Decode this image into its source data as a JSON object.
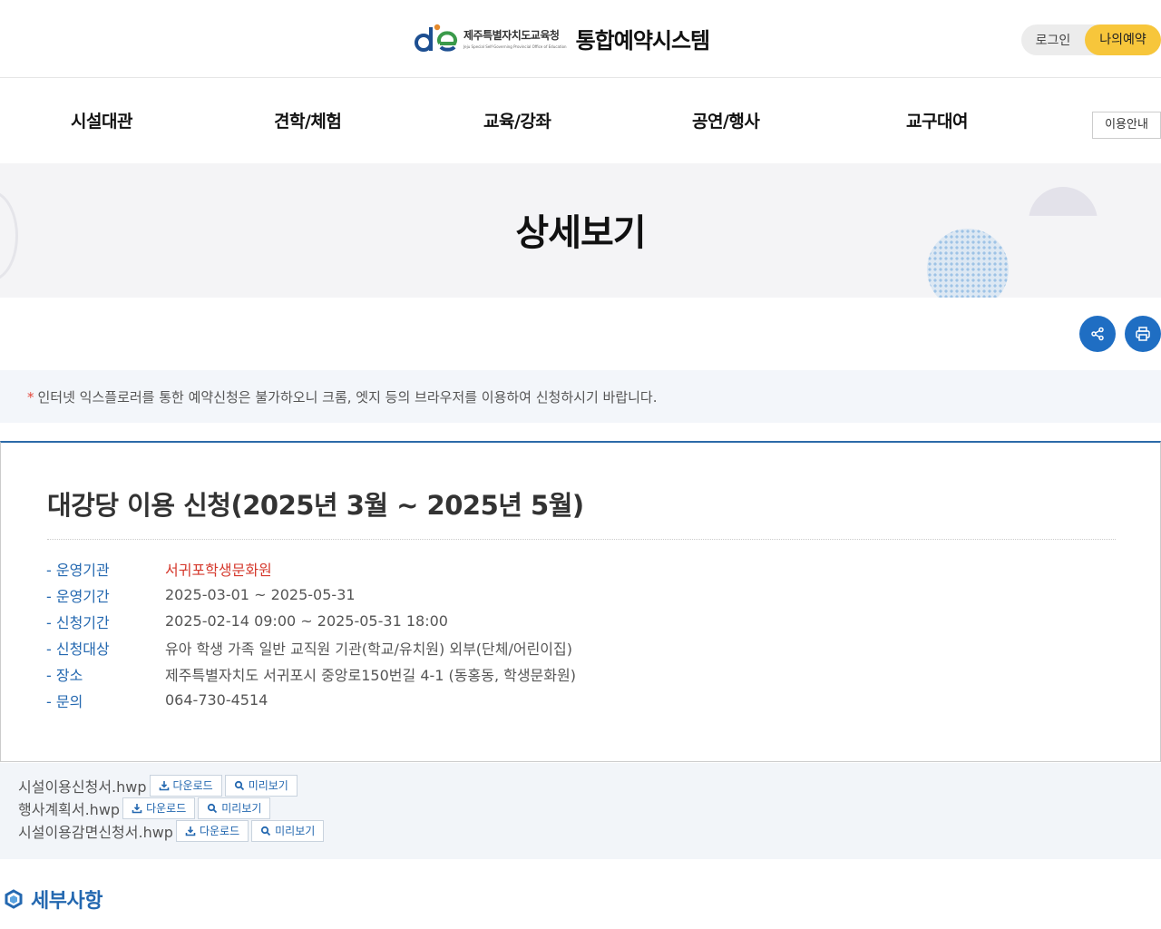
{
  "header": {
    "org_name": "제주특별자치도교육청",
    "org_name_en": "Jeju Special Self-Governing Provincial Office of Education",
    "system_title": "통합예약시스템",
    "login_label": "로그인",
    "my_reservation_label": "나의예약"
  },
  "nav": {
    "items": [
      {
        "label": "시설대관"
      },
      {
        "label": "견학/체험"
      },
      {
        "label": "교육/강좌"
      },
      {
        "label": "공연/행사"
      },
      {
        "label": "교구대여"
      }
    ],
    "guide_label": "이용안내"
  },
  "banner": {
    "title": "상세보기"
  },
  "actions": {
    "share_icon": "share-icon",
    "print_icon": "print-icon",
    "button_color": "#1f6ec3"
  },
  "notice": {
    "star": "*",
    "text": "인터넷 익스플로러를 통한 예약신청은 불가하오니 크롬, 엣지 등의 브라우저를 이용하여 신청하시기 바랍니다."
  },
  "detail": {
    "title": "대강당 이용 신청(2025년 3월 ~ 2025년 5월)",
    "info": [
      {
        "label": "- 운영기관",
        "value": "서귀포학생문화원"
      },
      {
        "label": "- 운영기간",
        "value": "2025-03-01 ~ 2025-05-31"
      },
      {
        "label": "- 신청기간",
        "value": "2025-02-14 09:00 ~ 2025-05-31 18:00"
      },
      {
        "label": "- 신청대상",
        "value": "유아 학생 가족 일반 교직원 기관(학교/유치원) 외부(단체/어린이집)"
      },
      {
        "label": "- 장소",
        "value": "제주특별자치도 서귀포시 중앙로150번길 4-1 (동홍동, 학생문화원)"
      },
      {
        "label": "- 문의",
        "value": "064-730-4514"
      }
    ]
  },
  "attachments": {
    "download_label": "다운로드",
    "preview_label": "미리보기",
    "files": [
      {
        "name": "시설이용신청서.hwp"
      },
      {
        "name": "행사계획서.hwp"
      },
      {
        "name": "시설이용감면신청서.hwp"
      }
    ]
  },
  "section": {
    "title": "세부사항"
  },
  "colors": {
    "accent": "#2468b0",
    "highlight": "#f7c63b",
    "red": "#d5392d"
  }
}
